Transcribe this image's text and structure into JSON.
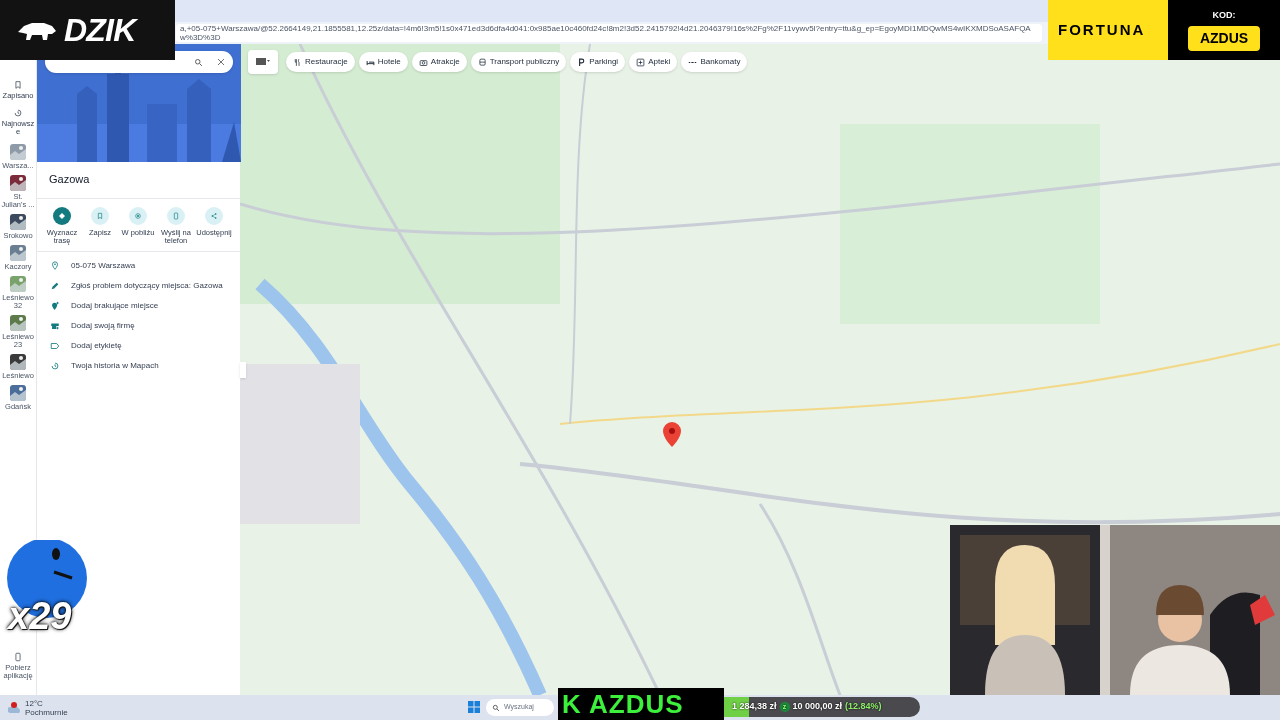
{
  "browser": {
    "url": "a,+05-075+Warszawa/@52.2664149,21.1855581,12.25z/data=!4m6!3m5!1s0x471ed3d6dfa4d041:0x985ae10c460fd24c!8m2!3d52.2415792!4d21.2046379!16s%2Fg%2F11vywv5l?entry=ttu&g_ep=EgoyMDI1MDQwMS4wIKXMDSoASAFQAw%3D%3D"
  },
  "logo": {
    "text": "DZIK"
  },
  "ad": {
    "brand": "FORTUNA",
    "code_label": "KOD:",
    "code": "AZDUS"
  },
  "rail": {
    "top": [
      "Zapisano",
      "Najnowsze"
    ],
    "recents": [
      "Warsza...",
      "St. Julian's ...",
      "Srokowo",
      "Kaczory",
      "Leśniewo 32",
      "Leśniewo 23",
      "Leśniewo",
      "Gdańsk"
    ],
    "bottom": "Pobierz aplikację"
  },
  "place": {
    "title": "Gazowa",
    "actions": [
      {
        "label": "Wyznacz trasę",
        "selected": true
      },
      {
        "label": "Zapisz",
        "selected": false
      },
      {
        "label": "W pobliżu",
        "selected": false
      },
      {
        "label": "Wyślij na telefon",
        "selected": false
      },
      {
        "label": "Udostępnij",
        "selected": false
      }
    ],
    "rows": [
      "05-075 Warszawa",
      "Zgłoś problem dotyczący miejsca: Gazowa",
      "Dodaj brakujące miejsce",
      "Dodaj swoją firmę",
      "Dodaj etykietę",
      "Twoja historia w Mapach"
    ]
  },
  "chips": [
    "Restauracje",
    "Hotele",
    "Atrakcje",
    "Transport publiczny",
    "Parkingi",
    "Apteki",
    "Bankomaty"
  ],
  "sticker": {
    "count": "x29"
  },
  "goal": {
    "name": "K AZDUS",
    "current": "1 284,38 zł",
    "currency": "z",
    "target": "10 000,00 zł",
    "percent": "(12.84%)",
    "level": 0.1284
  },
  "taskbar": {
    "temperature": "12°C",
    "weather": "Pochmurnie",
    "search_placeholder": "Wyszukaj"
  }
}
